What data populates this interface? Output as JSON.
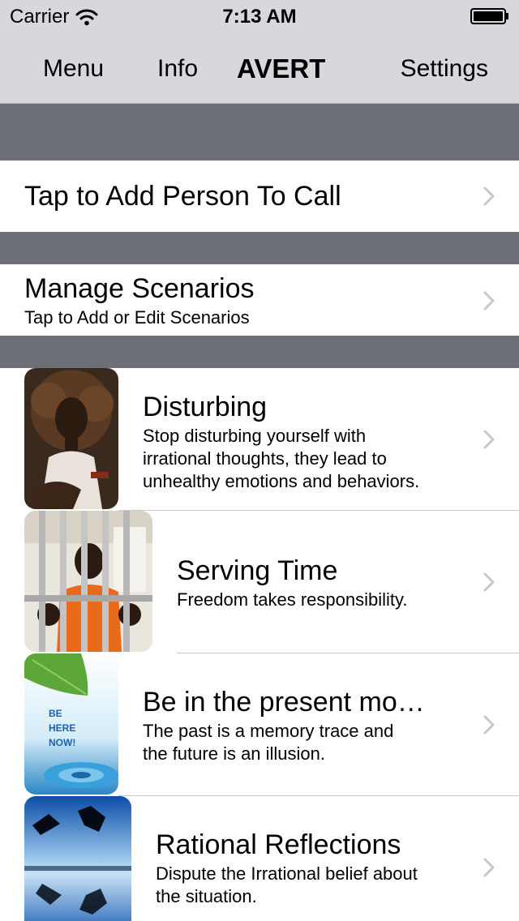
{
  "status_bar": {
    "carrier": "Carrier",
    "time": "7:13 AM"
  },
  "nav": {
    "menu_label": "Menu",
    "info_label": "Info",
    "title": "AVERT",
    "settings_label": "Settings"
  },
  "add_person": {
    "label": "Tap to Add Person To Call"
  },
  "manage_scenarios": {
    "title": "Manage Scenarios",
    "subtitle": "Tap to Add or Edit Scenarios"
  },
  "scenarios": [
    {
      "title": "Disturbing",
      "description": "Stop disturbing yourself with\nirrational thoughts, they lead to\nunhealthy emotions and behaviors.",
      "image": "woman-portrait-photo"
    },
    {
      "title": "Serving Time",
      "description": "Freedom takes responsibility.",
      "image": "man-behind-bars-photo"
    },
    {
      "title": "Be in the present mo…",
      "description": "The past is a memory trace and\nthe future is an illusion.",
      "image": "be-here-now-water-drop-photo",
      "image_text": "BE HERE NOW!"
    },
    {
      "title": "Rational Reflections",
      "description": "Dispute the Irrational belief about\nthe situation.",
      "image": "jumping-silhouettes-reflection-photo"
    }
  ],
  "colors": {
    "nav_bg": "#d8d8dc",
    "separator": "#6d7079",
    "chevron": "#c7c7cc"
  }
}
